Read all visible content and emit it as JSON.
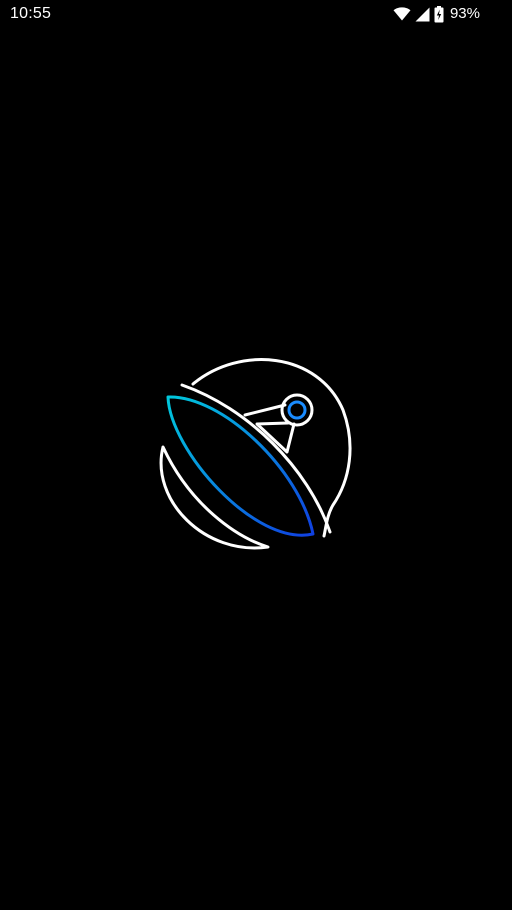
{
  "status_bar": {
    "time": "10:55",
    "battery_percent": "93%",
    "icons": [
      "wifi-icon",
      "cellular-signal-icon",
      "battery-charging-icon"
    ]
  },
  "splash": {
    "logo": "satellite-dish-logo-icon",
    "colors": {
      "background": "#000000",
      "outline": "#ffffff",
      "dish_gradient_start": "#00c8dc",
      "dish_gradient_end": "#1040e0",
      "receiver": "#1a8cff"
    }
  }
}
